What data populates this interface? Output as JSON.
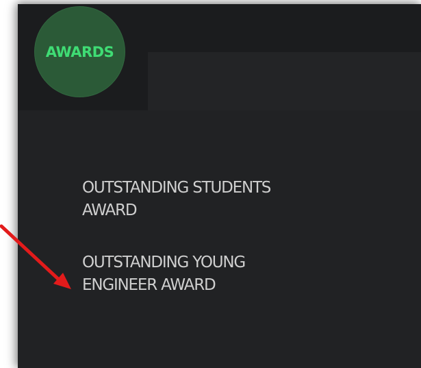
{
  "logo": {
    "text": "AWARDS"
  },
  "menu": {
    "items": [
      {
        "label_line1": "OUTSTANDING STUDENTS",
        "label_line2": "AWARD"
      },
      {
        "label_line1": "OUTSTANDING YOUNG",
        "label_line2": "ENGINEER AWARD"
      }
    ]
  },
  "annotation": {
    "arrow_color": "#e21b1b",
    "points_to": "menu.items.1"
  },
  "colors": {
    "background": "#212224",
    "header": "#1b1c1e",
    "logo_fill": "#2b5a37",
    "logo_text": "#3fdc74",
    "menu_text": "#cfcfcf"
  }
}
